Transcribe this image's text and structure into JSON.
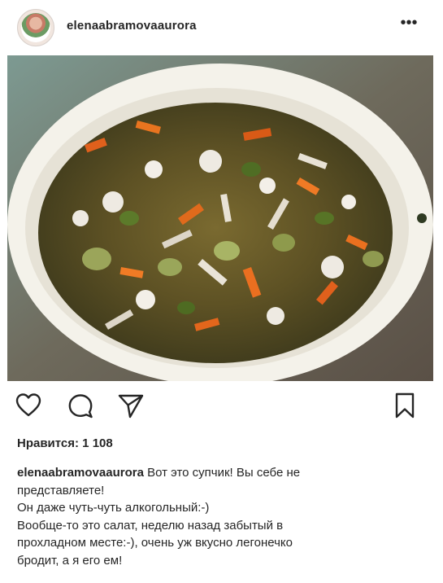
{
  "post": {
    "username": "elenaabramovaaurora",
    "more_label": "•••",
    "image_alt": "photo-soup-bowl",
    "likes_label": "Нравится: 1 108",
    "caption": {
      "username": "elenaabramovaaurora",
      "lines": [
        " Вот это супчик! Вы себе не",
        "представляете!",
        "Он даже чуть-чуть алкогольный:-)",
        "Вообще-то это салат, неделю назад забытый в",
        "прохладном месте:-), очень уж вкусно легонечко",
        "бродит, а я его ем!"
      ]
    },
    "icons": {
      "like": "heart-icon",
      "comment": "speech-bubble-icon",
      "share": "paper-plane-icon",
      "save": "bookmark-icon"
    },
    "colors": {
      "text": "#262626",
      "bowl": "#f7f5ef",
      "soup": "#6b5b2a"
    }
  }
}
